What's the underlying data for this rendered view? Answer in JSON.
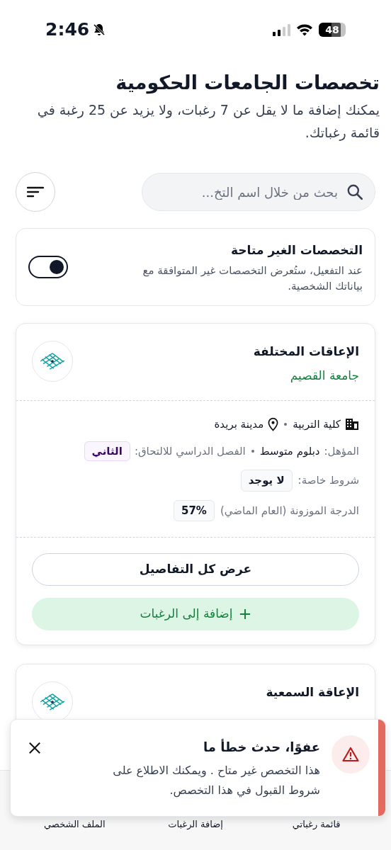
{
  "status_bar": {
    "time": "2:46",
    "battery": "48"
  },
  "header": {
    "title": "تخصصات الجامعات الحكومية",
    "description": "يمكنك إضافة ما لا يقل عن 7 رغبات، ولا يزيد عن 25 رغبة في قائمة رغباتك."
  },
  "search": {
    "placeholder": "بحث من خلال اسم التخ..."
  },
  "unavailable_filter": {
    "title": "التخصصات الغير متاحة",
    "description": "عند التفعيل، ستُعرض التخصصات غير المتوافقة مع بياناتك الشخصية.",
    "on": true
  },
  "programs": [
    {
      "name": "الإعاقات المختلفة",
      "university": "جامعة القصيم",
      "college": "كلية التربية",
      "city": "مدينة بريدة",
      "qualification_label": "المؤهل:",
      "qualification": "دبلوم متوسط",
      "semester_label": "الفصل الدراسي للالتحاق:",
      "semester": "الثاني",
      "conditions_label": "شروط خاصة:",
      "conditions": "لا يوجد",
      "score_label": "الدرجة الموزونة (العام الماضي)",
      "score": "57%",
      "details_button": "عرض كل التفاصيل",
      "add_button": "إضافة إلى الرغبات"
    },
    {
      "name": "الإعاقة السمعية"
    }
  ],
  "toast": {
    "title": "عفوًا، حدث خطأ ما",
    "message": "هذا التخصص غير متاح . ويمكنك الاطلاع على شروط القبول في هذا التخصص."
  },
  "bottom_nav": [
    {
      "label": "قائمة رغباتي"
    },
    {
      "label": "إضافة الرغبات"
    },
    {
      "label": "الملف الشخصي"
    }
  ]
}
